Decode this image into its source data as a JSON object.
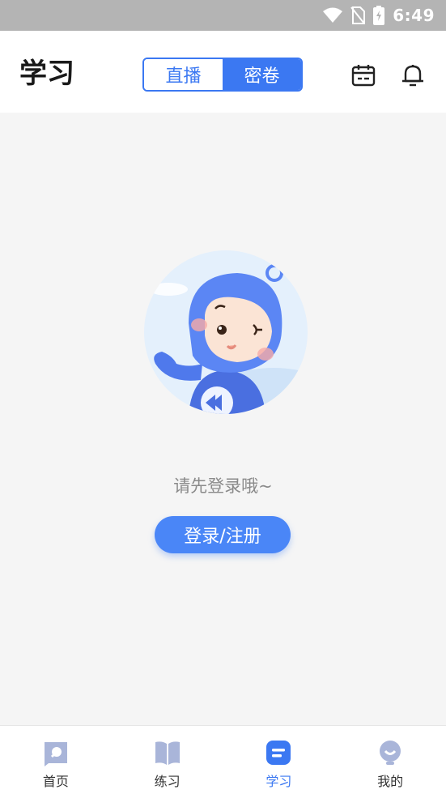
{
  "status_bar": {
    "time": "6:49"
  },
  "header": {
    "title": "学习",
    "tabs": [
      {
        "label": "直播",
        "selected": false
      },
      {
        "label": "密卷",
        "selected": true
      }
    ],
    "icons": [
      "calendar-icon",
      "bell-icon"
    ]
  },
  "main": {
    "prompt": "请先登录哦~",
    "login_button": "登录/注册"
  },
  "tabbar": {
    "items": [
      {
        "label": "首页",
        "icon": "home-icon"
      },
      {
        "label": "练习",
        "icon": "book-icon"
      },
      {
        "label": "学习",
        "icon": "study-icon",
        "active": true
      },
      {
        "label": "我的",
        "icon": "profile-icon"
      }
    ]
  },
  "colors": {
    "accent": "#3b78f2",
    "button": "#4a86f7",
    "tab_inactive_icon": "#a9b5d9"
  }
}
